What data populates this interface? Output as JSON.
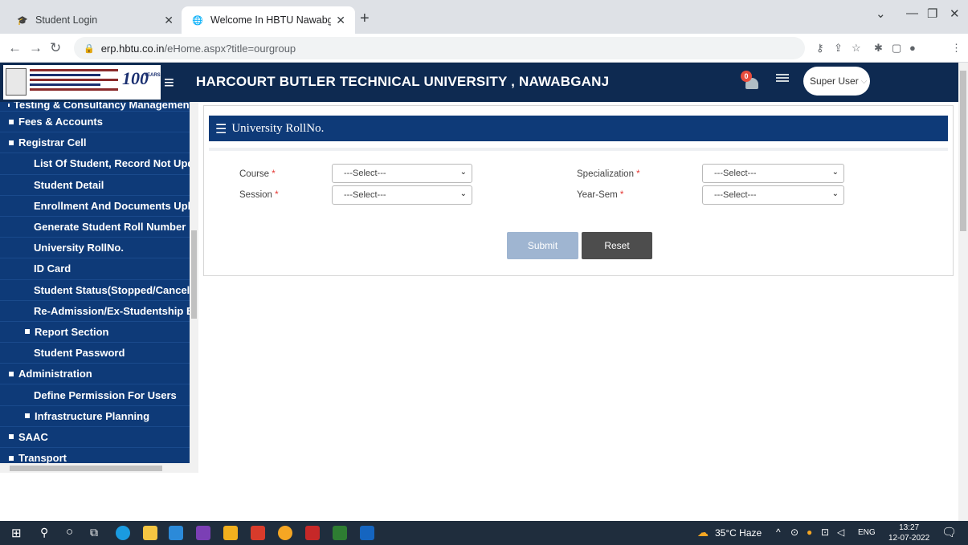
{
  "browser": {
    "tabs": [
      {
        "title": "Student Login",
        "active": false
      },
      {
        "title": "Welcome In HBTU Nawabganj Ca",
        "active": true
      }
    ],
    "url_domain": "erp.hbtu.co.in",
    "url_path": "/eHome.aspx?title=ourgroup"
  },
  "header": {
    "logo_text": "100",
    "logo_years": "YEARS",
    "title": "HARCOURT BUTLER TECHNICAL UNIVERSITY , NAWABGANJ",
    "notification_count": "0",
    "user_label": "Super User"
  },
  "sidebar": {
    "items": [
      {
        "label": "Testing & Consultancy Management",
        "marker": "plus"
      },
      {
        "label": "Fees & Accounts",
        "marker": "plus"
      },
      {
        "label": "Registrar Cell",
        "marker": "minus"
      },
      {
        "label": "List Of Student, Record Not Updated",
        "marker": "none"
      },
      {
        "label": "Student Detail",
        "marker": "none"
      },
      {
        "label": "Enrollment And Documents Upload",
        "marker": "none"
      },
      {
        "label": "Generate Student Roll Number",
        "marker": "none"
      },
      {
        "label": "University RollNo.",
        "marker": "none"
      },
      {
        "label": "ID Card",
        "marker": "none"
      },
      {
        "label": "Student Status(Stopped/Cancelled)",
        "marker": "none"
      },
      {
        "label": "Re-Admission/Ex-Studentship Entry",
        "marker": "none"
      },
      {
        "label": "Report Section",
        "marker": "plus"
      },
      {
        "label": "Student Password",
        "marker": "none"
      },
      {
        "label": "Administration",
        "marker": "minus"
      },
      {
        "label": "Define Permission For Users",
        "marker": "none"
      },
      {
        "label": "Infrastructure Planning",
        "marker": "plus"
      },
      {
        "label": "SAAC",
        "marker": "plus"
      },
      {
        "label": "Transport",
        "marker": "plus"
      }
    ]
  },
  "panel": {
    "title": "University RollNo.",
    "fields": {
      "course": {
        "label": "Course",
        "value": "---Select---"
      },
      "specialization": {
        "label": "Specialization",
        "value": "---Select---"
      },
      "session": {
        "label": "Session",
        "value": "---Select---"
      },
      "year_sem": {
        "label": "Year-Sem",
        "value": "---Select---"
      }
    },
    "required_mark": "*",
    "submit_label": "Submit",
    "reset_label": "Reset"
  },
  "taskbar": {
    "weather": "35°C  Haze",
    "language": "ENG",
    "time": "13:27",
    "date": "12-07-2022"
  }
}
